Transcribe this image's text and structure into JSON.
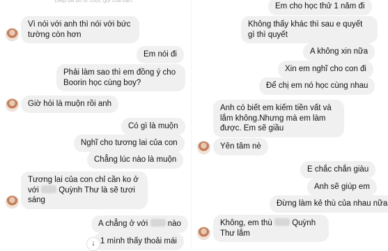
{
  "left": {
    "header_note": "Điệp đã bỏ lỡ cuộc gọi của bạn.",
    "messages": [
      {
        "from": "other",
        "text": "Vì nói với anh thì nói với bức tường còn hơn"
      },
      {
        "from": "me",
        "text": "Em nói đi"
      },
      {
        "from": "me",
        "text": "Phải làm sao thì em đồng ý cho Boorin học cùng boy?"
      },
      {
        "from": "other",
        "text": "Giờ hỏi là muộn rồi anh"
      },
      {
        "from": "me",
        "text": "Có gì là muộn"
      },
      {
        "from": "me",
        "text": "Nghĩ cho tương lai của con"
      },
      {
        "from": "me",
        "text": "Chẳng lúc nào là muộn"
      },
      {
        "from": "other",
        "text_a": "Tương lai của con chỉ cần ko ở với",
        "text_b": "Quỳnh Thư là sẽ tươi sáng"
      },
      {
        "from": "me",
        "text_a": "A chẳng ở với",
        "text_b": "nào"
      },
      {
        "from": "me",
        "text": "1 mình thấy thoải mái"
      }
    ]
  },
  "right": {
    "messages": [
      {
        "from": "me",
        "text": "Em cho học thử 1 năm đi"
      },
      {
        "from": "me",
        "text": "Không thấy khác thì sau e quyết gì thì quyết"
      },
      {
        "from": "me",
        "text": "A không xin nữa"
      },
      {
        "from": "me",
        "text": "Xin em nghĩ cho con đi"
      },
      {
        "from": "me",
        "text": "Để chị em nó học cùng nhau"
      },
      {
        "from": "other",
        "text": "Anh có biết em kiếm tiền vất và lắm không.Nhưng mà em làm được. Em sẽ giầu"
      },
      {
        "from": "other",
        "text": "Yên tâm nè"
      },
      {
        "from": "me",
        "text": "E chắc chắn giàu"
      },
      {
        "from": "me",
        "text": "Anh sẽ giúp em"
      },
      {
        "from": "me",
        "text": "Đừng làm kẻ thù của nhau nữa"
      },
      {
        "from": "other",
        "text_a": "Không, em thù",
        "text_b": "Quỳnh Thư lắm"
      }
    ]
  },
  "scroll_icon": "arrow-down-icon",
  "colors": {
    "bubble": "#f0f0f0",
    "background": "#ffffff"
  }
}
